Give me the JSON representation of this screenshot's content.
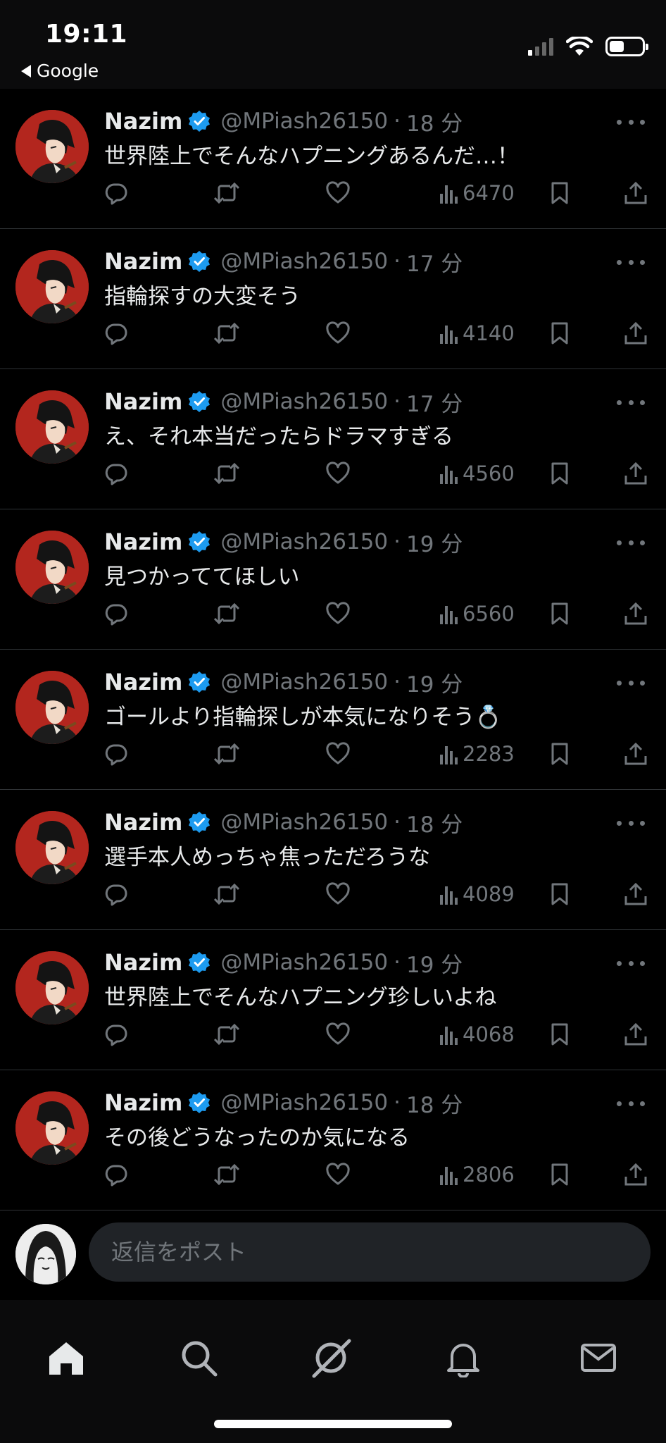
{
  "status_bar": {
    "time": "19:11",
    "back_app": "Google",
    "icons": [
      "signal-icon",
      "wifi-icon",
      "battery-icon"
    ]
  },
  "posts": [
    {
      "name": "Nazim",
      "handle": "@MPiash26150",
      "time": "18 分",
      "text": "世界陸上でそんなハプニングあるんだ…！",
      "views": "6470"
    },
    {
      "name": "Nazim",
      "handle": "@MPiash26150",
      "time": "17 分",
      "text": "指輪探すの大変そう",
      "views": "4140"
    },
    {
      "name": "Nazim",
      "handle": "@MPiash26150",
      "time": "17 分",
      "text": "え、それ本当だったらドラマすぎる",
      "views": "4560"
    },
    {
      "name": "Nazim",
      "handle": "@MPiash26150",
      "time": "19 分",
      "text": "見つかっててほしい",
      "views": "6560"
    },
    {
      "name": "Nazim",
      "handle": "@MPiash26150",
      "time": "19 分",
      "text": "ゴールより指輪探しが本気になりそう💍",
      "views": "2283"
    },
    {
      "name": "Nazim",
      "handle": "@MPiash26150",
      "time": "18 分",
      "text": "選手本人めっちゃ焦っただろうな",
      "views": "4089"
    },
    {
      "name": "Nazim",
      "handle": "@MPiash26150",
      "time": "19 分",
      "text": "世界陸上でそんなハプニング珍しいよね",
      "views": "4068"
    },
    {
      "name": "Nazim",
      "handle": "@MPiash26150",
      "time": "18 分",
      "text": "その後どうなったのか気になる",
      "views": "2806"
    }
  ],
  "reply": {
    "placeholder": "返信をポスト"
  },
  "bottom_nav": [
    "home-icon",
    "search-icon",
    "grok-icon",
    "notifications-icon",
    "messages-icon"
  ],
  "colors": {
    "background": "#000000",
    "text": "#e7e9ea",
    "muted": "#71767b",
    "verified": "#1d9bf0",
    "divider": "#2f3336",
    "avatar_red": "#b3261e"
  }
}
